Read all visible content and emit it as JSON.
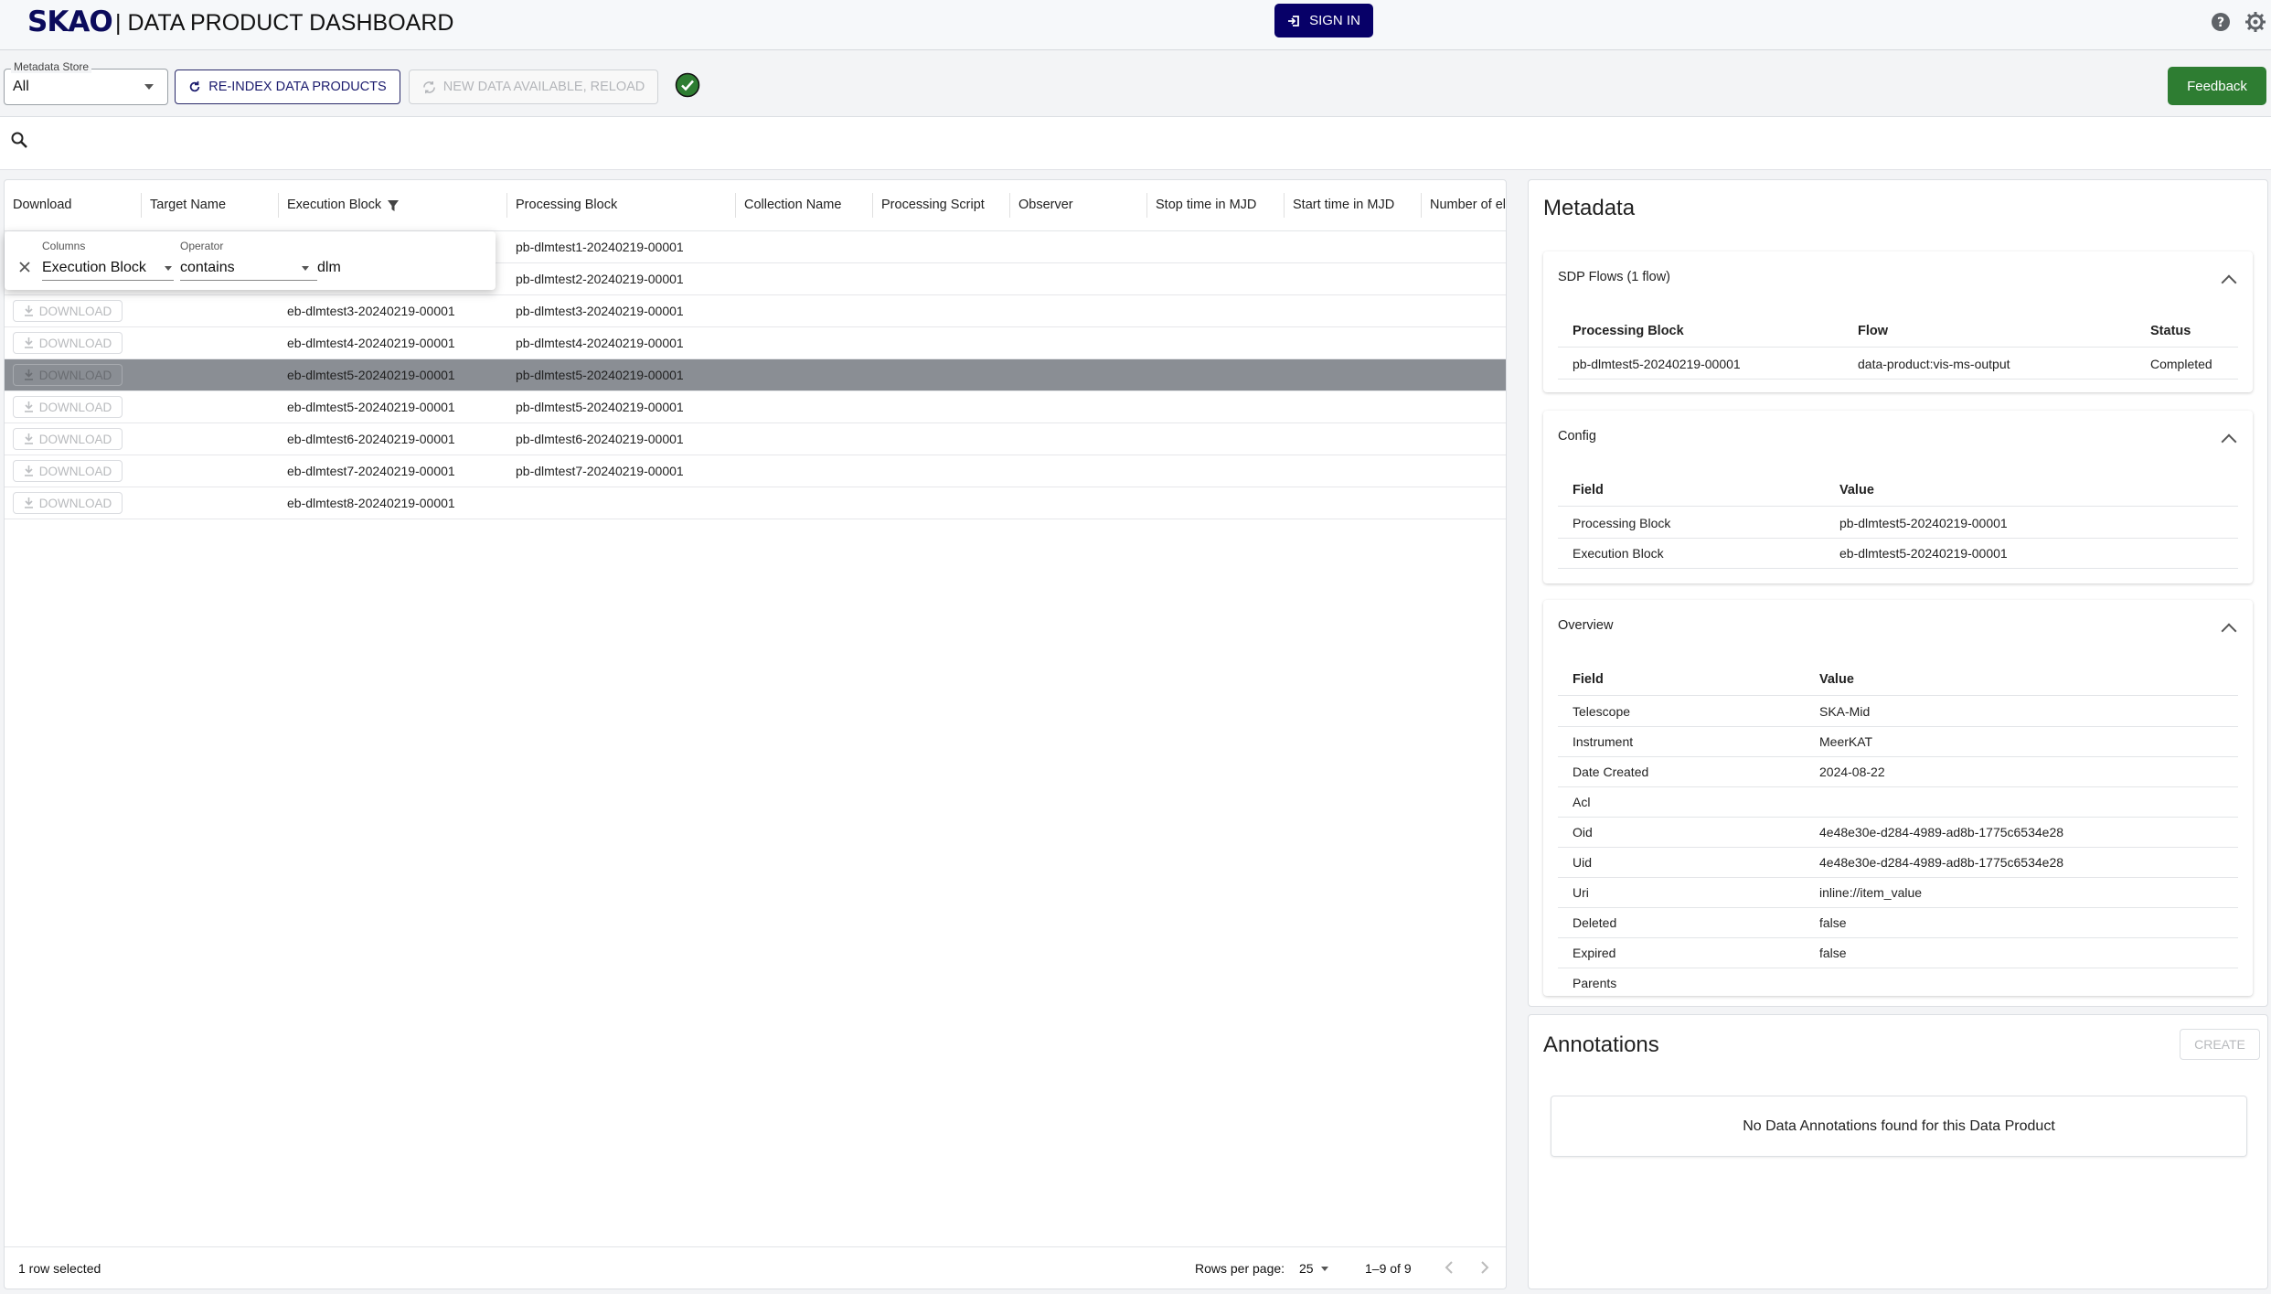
{
  "header": {
    "logo": "SKAO",
    "title": "| DATA PRODUCT DASHBOARD",
    "signin_label": "SIGN IN"
  },
  "toolbar": {
    "metadata_store_label": "Metadata Store",
    "metadata_store_value": "All",
    "reindex_label": "RE-INDEX DATA PRODUCTS",
    "new_data_label": "NEW DATA AVAILABLE, RELOAD",
    "feedback_label": "Feedback"
  },
  "grid": {
    "columns": [
      "Download",
      "Target Name",
      "Execution Block",
      "Processing Block",
      "Collection Name",
      "Processing Script",
      "Observer",
      "Stop time in MJD",
      "Start time in MJD",
      "Number of el"
    ],
    "filter": {
      "columns_label": "Columns",
      "columns_value": "Execution Block",
      "operator_label": "Operator",
      "operator_value": "contains",
      "value": "dlm"
    },
    "download_label": "DOWNLOAD",
    "rows": [
      {
        "eb": "",
        "pb": "pb-dlmtest1-20240219-00001"
      },
      {
        "eb": "",
        "pb": "pb-dlmtest2-20240219-00001"
      },
      {
        "eb": "eb-dlmtest3-20240219-00001",
        "pb": "pb-dlmtest3-20240219-00001"
      },
      {
        "eb": "eb-dlmtest4-20240219-00001",
        "pb": "pb-dlmtest4-20240219-00001"
      },
      {
        "eb": "eb-dlmtest5-20240219-00001",
        "pb": "pb-dlmtest5-20240219-00001"
      },
      {
        "eb": "eb-dlmtest5-20240219-00001",
        "pb": "pb-dlmtest5-20240219-00001"
      },
      {
        "eb": "eb-dlmtest6-20240219-00001",
        "pb": "pb-dlmtest6-20240219-00001"
      },
      {
        "eb": "eb-dlmtest7-20240219-00001",
        "pb": "pb-dlmtest7-20240219-00001"
      },
      {
        "eb": "eb-dlmtest8-20240219-00001",
        "pb": ""
      }
    ],
    "selected_row_index": 4,
    "footer": {
      "selected_text": "1 row selected",
      "rows_per_page_label": "Rows per page:",
      "rows_per_page_value": "25",
      "range_text": "1–9 of 9"
    }
  },
  "metadata": {
    "title": "Metadata",
    "sdp_flows": {
      "title": "SDP Flows (1 flow)",
      "headers": [
        "Processing Block",
        "Flow",
        "Status"
      ],
      "rows": [
        [
          "pb-dlmtest5-20240219-00001",
          "data-product:vis-ms-output",
          "Completed"
        ]
      ]
    },
    "config": {
      "title": "Config",
      "headers": [
        "Field",
        "Value"
      ],
      "rows": [
        [
          "Processing Block",
          "pb-dlmtest5-20240219-00001"
        ],
        [
          "Execution Block",
          "eb-dlmtest5-20240219-00001"
        ]
      ]
    },
    "overview": {
      "title": "Overview",
      "headers": [
        "Field",
        "Value"
      ],
      "rows": [
        [
          "Telescope",
          "SKA-Mid"
        ],
        [
          "Instrument",
          "MeerKAT"
        ],
        [
          "Date Created",
          "2024-08-22"
        ],
        [
          "Acl",
          ""
        ],
        [
          "Oid",
          "4e48e30e-d284-4989-ad8b-1775c6534e28"
        ],
        [
          "Uid",
          "4e48e30e-d284-4989-ad8b-1775c6534e28"
        ],
        [
          "Uri",
          "inline://item_value"
        ],
        [
          "Deleted",
          "false"
        ],
        [
          "Expired",
          "false"
        ],
        [
          "Parents",
          ""
        ]
      ]
    }
  },
  "annotations": {
    "title": "Annotations",
    "create_label": "CREATE",
    "empty_text": "No Data Annotations found for this Data Product"
  },
  "colors": {
    "brand": "#070068",
    "feedback": "#2e7d32",
    "status_ok": "#2e7d32",
    "selected_row": "#8a8e94"
  }
}
